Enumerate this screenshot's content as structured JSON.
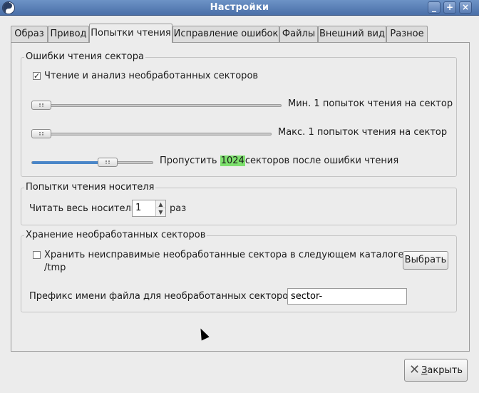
{
  "window": {
    "title": "Настройки",
    "minimize_glyph": "_",
    "maximize_glyph": "+",
    "close_glyph": "×"
  },
  "tabs": [
    {
      "label": "Образ"
    },
    {
      "label": "Привод"
    },
    {
      "label": "Попытки чтения",
      "active": true
    },
    {
      "label": "Исправление ошибок"
    },
    {
      "label": "Файлы"
    },
    {
      "label": "Внешний вид"
    },
    {
      "label": "Разное"
    }
  ],
  "sector_errors": {
    "title": "Ошибки чтения сектора",
    "raw_checkbox_label": "Чтение и анализ необработанных секторов",
    "raw_checked": true,
    "min_label": "Мин. 1 попыток чтения на сектор",
    "min_value": 1,
    "max_label": "Макс. 1 попыток чтения на сектор",
    "max_value": 1,
    "skip_prefix": "Пропустить",
    "skip_value": "1024",
    "skip_suffix": "секторов после ошибки чтения",
    "skip_slider_fraction": 0.65
  },
  "medium_attempts": {
    "title": "Попытки чтения носителя",
    "read_label": "Читать весь носитель",
    "read_value": "1",
    "times_label": "раз"
  },
  "raw_storage": {
    "title": "Хранение необработанных секторов",
    "store_checkbox_label": "Хранить неисправимые необработанные сектора в следующем каталоге:",
    "store_checked": false,
    "directory": "/tmp",
    "choose_button": "Выбрать",
    "prefix_label": "Префикс имени файла для необработанных секторов:",
    "prefix_value": "sector-"
  },
  "footer": {
    "close_button_mnemonic": "З",
    "close_button_rest": "акрыть"
  },
  "colors": {
    "titlebar": "#4a6fa8",
    "highlight": "#7de06d",
    "slider_fill": "#4a86c8"
  }
}
